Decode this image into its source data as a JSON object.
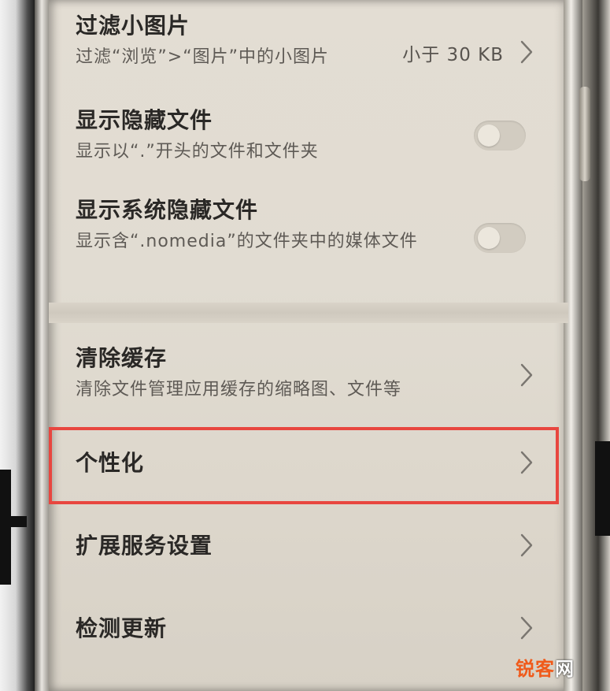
{
  "settings": {
    "filter_small_images": {
      "title": "过滤小图片",
      "subtitle": "过滤“浏览”>“图片”中的小图片",
      "value": "小于 30 KB"
    },
    "show_hidden_files": {
      "title": "显示隐藏文件",
      "subtitle": "显示以“.”开头的文件和文件夹",
      "enabled": false
    },
    "show_system_hidden_files": {
      "title": "显示系统隐藏文件",
      "subtitle": "显示含“.nomedia”的文件夹中的媒体文件",
      "enabled": false
    },
    "clear_cache": {
      "title": "清除缓存",
      "subtitle": "清除文件管理应用缓存的缩略图、文件等"
    },
    "personalization": {
      "title": "个性化"
    },
    "extended_services": {
      "title": "扩展服务设置"
    },
    "check_updates": {
      "title": "检测更新"
    }
  },
  "annotation": {
    "highlight_color": "#e8463f"
  },
  "watermark": {
    "part1": "锐客",
    "part2": "网"
  }
}
